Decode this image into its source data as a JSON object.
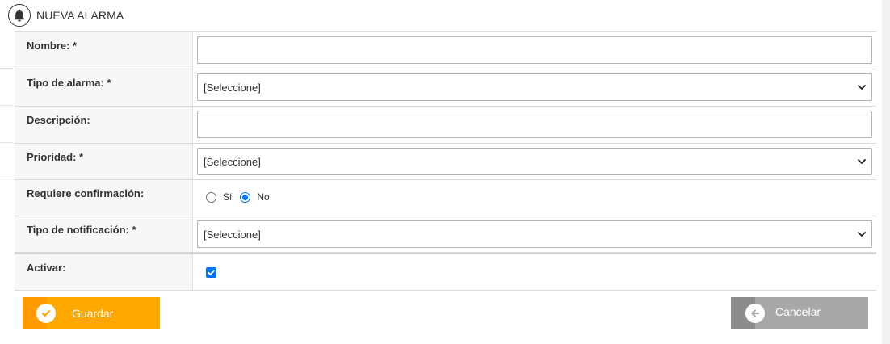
{
  "header": {
    "title": "NUEVA ALARMA",
    "icon": "bell-icon"
  },
  "form": {
    "nombre": {
      "label": "Nombre: *",
      "value": ""
    },
    "tipo_alarma": {
      "label": "Tipo de alarma: *",
      "selected": "[Seleccione]"
    },
    "descripcion": {
      "label": "Descripción:",
      "value": ""
    },
    "prioridad": {
      "label": "Prioridad: *",
      "selected": "[Seleccione]"
    },
    "requiere_confirmacion": {
      "label": "Requiere confirmación:",
      "options": [
        {
          "label": "Sí",
          "checked": false
        },
        {
          "label": "No",
          "checked": true
        }
      ]
    },
    "tipo_notificacion": {
      "label": "Tipo de notificación: *",
      "selected": "[Seleccione]"
    },
    "activar": {
      "label": "Activar:",
      "checked": true
    }
  },
  "buttons": {
    "save_label": "Guardar",
    "cancel_label": "Cancelar"
  },
  "colors": {
    "save_button": "#ffa800",
    "cancel_button": "#a8a8a8",
    "checkbox_accent": "#0075ff"
  }
}
